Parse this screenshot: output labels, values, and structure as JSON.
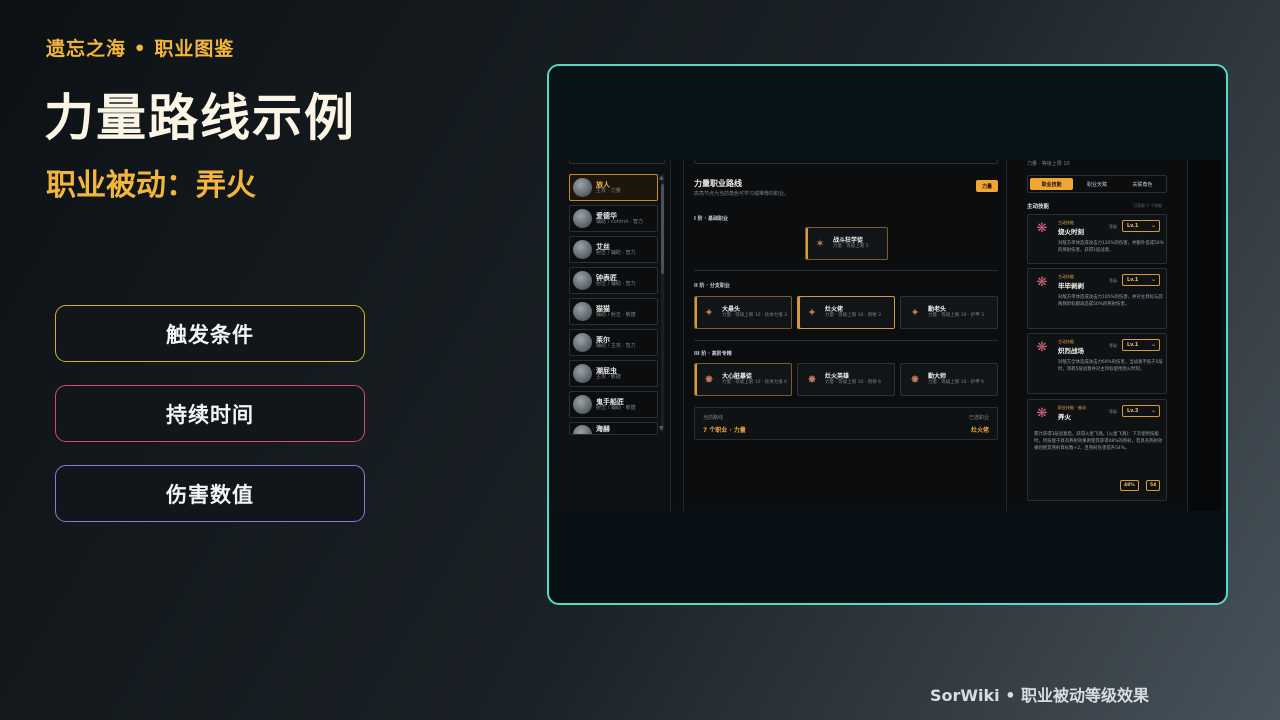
{
  "slide": {
    "kicker": "遗忘之海 • 职业图鉴",
    "title": "力量路线示例",
    "subtitle": "职业被动：弄火",
    "pills": [
      "触发条件",
      "持续时间",
      "伤害数值"
    ],
    "footer": "SorWiki • 职业被动等级效果"
  },
  "shot": {
    "list": [
      {
        "name": "旅人",
        "sub": "主攻 · 力量"
      },
      {
        "name": "爱德华",
        "sub": "辅助 / control · 智力"
      },
      {
        "name": "艾丝",
        "sub": "射击 / 辅助 · 智力"
      },
      {
        "name": "钟表匠",
        "sub": "射击 / 辅助 · 智力"
      },
      {
        "name": "猫猫",
        "sub": "辅助 / 射击 · 敏捷"
      },
      {
        "name": "莱尔",
        "sub": "辅助 / 主攻 · 智力"
      },
      {
        "name": "潮屁虫",
        "sub": "主攻 · 敏捷"
      },
      {
        "name": "鬼手船匠",
        "sub": "射击 / 辅助 · 敏捷"
      },
      {
        "name": "海赫",
        "sub": ""
      }
    ],
    "route": {
      "title": "力量职业路线",
      "desc": "高亮节点为当前角色可学习或推荐的职业。",
      "tag": "力量",
      "tier1": "I 阶 · 基础职业",
      "tier2": "II 阶 · 分支职业",
      "tier3": "III 阶 · 高阶专精",
      "n1": {
        "name": "战斗狂学徒",
        "sub": "力量 · 等级上限 5"
      },
      "t2": [
        {
          "name": "大悬头",
          "sub": "力量 · 等级上限 10 · 技体力值 3"
        },
        {
          "name": "灶火佬",
          "sub": "力量 · 等级上限 10 · 燕射 3"
        },
        {
          "name": "勤老头",
          "sub": "力量 · 等级上限 10 · 护甲 3"
        }
      ],
      "t3": [
        {
          "name": "大心脏暴徒",
          "sub": "力量 · 等级上限 10 · 技体力值 6"
        },
        {
          "name": "灶火英雄",
          "sub": "力量 · 等级上限 10 · 燕射 6"
        },
        {
          "name": "勤大师",
          "sub": "力量 · 等级上限 10 · 护甲 6"
        }
      ],
      "sum_l1": "当前路线",
      "sum_l2": "7 个职业 · 力量",
      "sum_r1": "已选职业",
      "sum_r2": "灶火佬"
    },
    "right": {
      "top": "力量 · 等级上限 10",
      "tabs": [
        "职业技能",
        "职业天赋",
        "关联角色"
      ],
      "sec": "主动技能",
      "sec_r": "可获取 3 个技能",
      "lvl_label": "等级",
      "skills": [
        {
          "kind": "主动技能",
          "name": "烧火时刻",
          "lvl": "Lv.1",
          "desc": "对敌方单体造成攻击力120%的伤害，并额外造成50%的燕射伤害，获得1层战意。"
        },
        {
          "kind": "主动技能",
          "name": "毕毕剥剥",
          "lvl": "Lv.1",
          "desc": "对敌方单体造成攻击力105%的伤害，并对主目标与其两侧目标都再造成50%的燕射伤害。"
        },
        {
          "kind": "主动技能",
          "name": "炽烈战场",
          "lvl": "Lv.1",
          "desc": "对敌方全体造成攻击力60%的伤害，当战意不低于5层时，消耗5层战意并对主目标使用烧火时刻。"
        },
        {
          "kind": "职业技能 · 被动",
          "name": "弄火",
          "lvl": "Lv.3",
          "desc": "累计获得3层战意后，获得火星飞溅。[火星飞溅]：下次使用技能时，所技能子具有燕射效果则使其获得48%的燕射，若具有燕射效果则使其燕射目标数+2，且燕射伤害提升54%。",
          "badges": [
            "48%",
            "54"
          ]
        }
      ]
    }
  }
}
